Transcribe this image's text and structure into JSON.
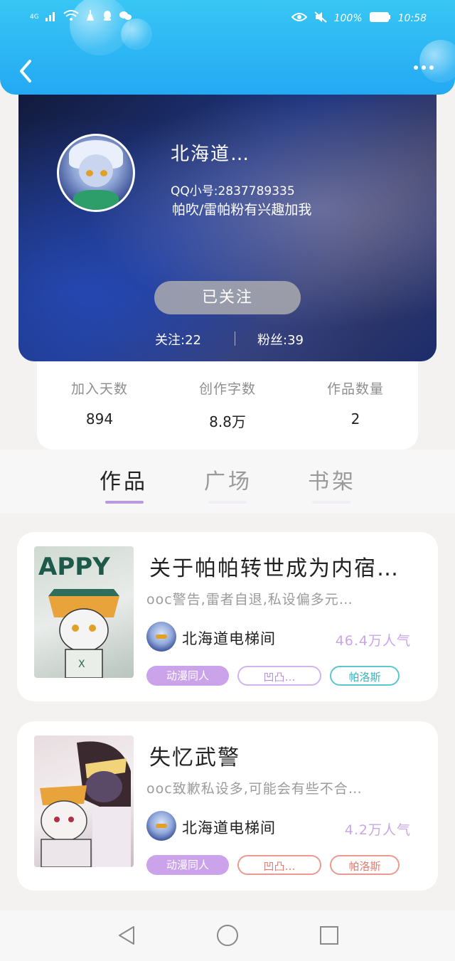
{
  "status_bar": {
    "network": "4G",
    "battery": "100%",
    "time": "10:58"
  },
  "profile": {
    "name": "北海道…",
    "qq": "QQ小号:2837789335",
    "bio": "帕吹/雷帕粉有兴趣加我",
    "follow_button": "已关注",
    "following": "关注:22",
    "fans": "粉丝:39"
  },
  "stats": [
    {
      "label": "加入天数",
      "value": "894"
    },
    {
      "label": "创作字数",
      "value": "8.8万"
    },
    {
      "label": "作品数量",
      "value": "2"
    }
  ],
  "tabs": [
    {
      "label": "作品",
      "active": true
    },
    {
      "label": "广场",
      "active": false
    },
    {
      "label": "书架",
      "active": false
    }
  ],
  "works": [
    {
      "title": "关于帕帕转世成为内宿…",
      "desc": "ooc警告,雷者自退,私设偏多元…",
      "author": "北海道电梯间",
      "popularity": "46.4万人气",
      "tags": [
        "动漫同人",
        "凹凸…",
        "帕洛斯"
      ]
    },
    {
      "title": "失忆武警",
      "desc": "ooc致歉私设多,可能会有些不合…",
      "author": "北海道电梯间",
      "popularity": "4.2万人气",
      "tags": [
        "动漫同人",
        "凹凸…",
        "帕洛斯"
      ]
    }
  ],
  "colors": {
    "header": "#2aaff3",
    "accent_purple": "#caa3ea",
    "tag_teal": "#5cc7cf",
    "tag_red": "#ea9a92"
  },
  "icons": [
    "back-arrow-icon",
    "more-dots-icon",
    "nav-back-icon",
    "nav-home-icon",
    "nav-recent-icon"
  ]
}
